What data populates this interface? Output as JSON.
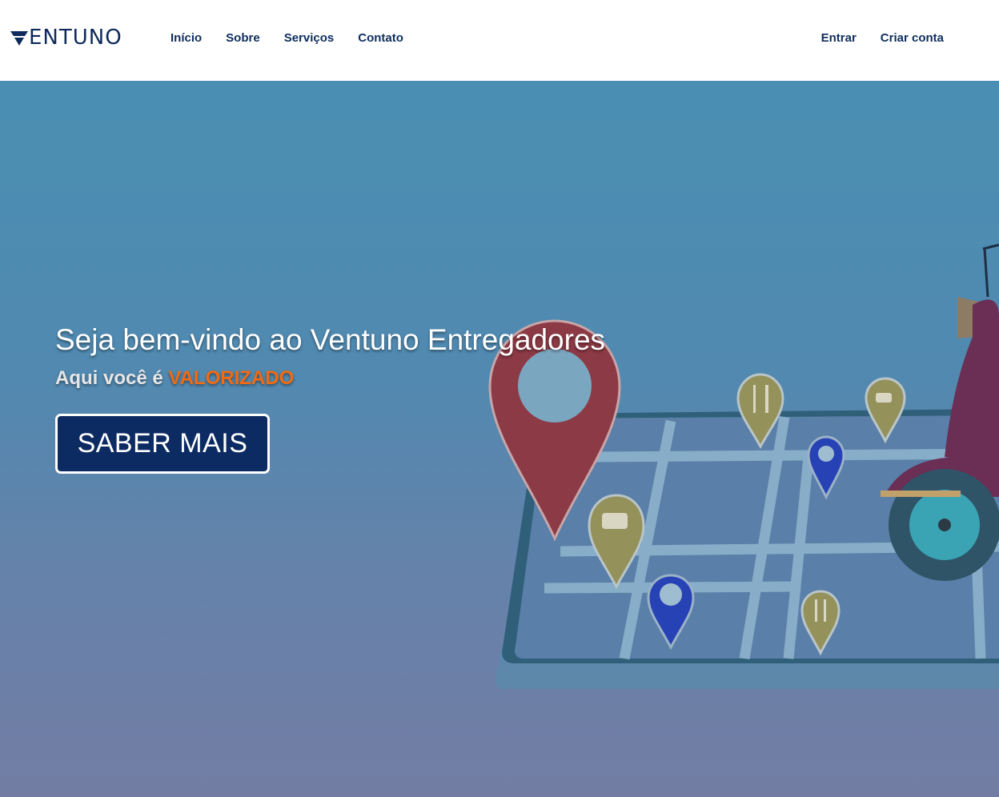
{
  "brand": {
    "name": "ENTUNO",
    "logo_icon": "v-chevron-icon",
    "color": "#0e2a5c"
  },
  "nav": {
    "items": [
      {
        "label": "Início"
      },
      {
        "label": "Sobre"
      },
      {
        "label": "Serviços"
      },
      {
        "label": "Contato"
      }
    ]
  },
  "auth": {
    "login_label": "Entrar",
    "signup_label": "Criar conta"
  },
  "hero": {
    "title": "Seja bem-vindo ao Ventuno Entregadores",
    "subtitle_prefix": "Aqui você é ",
    "subtitle_highlight": "VALORIZADO",
    "cta_label": "SABER MAIS",
    "highlight_color": "#f26a12",
    "cta_color": "#0d2b63"
  },
  "illustration": {
    "pins": [
      "location-pin-icon",
      "fork-knife-pin-icon",
      "coffee-cup-pin-icon",
      "location-pin-icon",
      "coffee-cup-pin-icon",
      "location-pin-icon",
      "fork-knife-pin-icon"
    ],
    "vehicle": "scooter-icon",
    "device": "tablet-map-icon"
  }
}
